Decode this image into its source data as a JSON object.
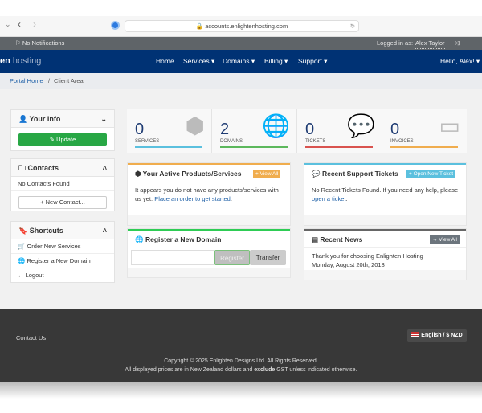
{
  "browser": {
    "url": "accounts.enlightenhosting.com"
  },
  "topbar": {
    "notifications": "No Notifications",
    "logged_in_label": "Logged in as:",
    "user": "Alex Taylor"
  },
  "nav": {
    "logo_bold": "en",
    "logo_light": " hosting",
    "items": [
      "Home",
      "Services ▾",
      "Domains ▾",
      "Billing ▾",
      "Support ▾"
    ],
    "greeting": "Hello, Alex! ▾"
  },
  "breadcrumb": {
    "home": "Portal Home",
    "current": "Client Area"
  },
  "sidebar": {
    "your_info": "Your Info",
    "update": "Update",
    "contacts": "Contacts",
    "no_contacts": "No Contacts Found",
    "new_contact": "+ New Contact...",
    "shortcuts": "Shortcuts",
    "shortcut_items": [
      "Order New Services",
      "Register a New Domain",
      "Logout"
    ]
  },
  "stats": [
    {
      "value": "0",
      "label": "SERVICES",
      "color": "#5bc0de"
    },
    {
      "value": "2",
      "label": "DOMAINS",
      "color": "#5cb85c"
    },
    {
      "value": "0",
      "label": "TICKETS",
      "color": "#d9534f"
    },
    {
      "value": "0",
      "label": "INVOICES",
      "color": "#f0ad4e"
    }
  ],
  "products": {
    "title": "Your Active Products/Services",
    "view_all": "+ View All",
    "text": "It appears you do not have any products/services with us yet.",
    "link": "Place an order to get started",
    "after": "."
  },
  "tickets": {
    "title": "Recent Support Tickets",
    "open_new": "+ Open New Ticket",
    "text": "No Recent Tickets Found. If you need any help, please",
    "link": "open a ticket",
    "after": "."
  },
  "domain": {
    "title": "Register a New Domain",
    "register": "Register",
    "transfer": "Transfer"
  },
  "news": {
    "title": "Recent News",
    "view_all": "→ View All",
    "headline": "Thank you for choosing Enlighten Hosting",
    "date": "Monday, August 20th, 2018"
  },
  "footer": {
    "contact": "Contact Us",
    "language": "English / $ NZD",
    "copyright": "Copyright © 2025 Enlighten Designs Ltd. All Rights Reserved.",
    "prices_a": "All displayed prices are in New Zealand dollars and ",
    "prices_b": "exclude",
    "prices_c": " GST unless indicated otherwise."
  }
}
